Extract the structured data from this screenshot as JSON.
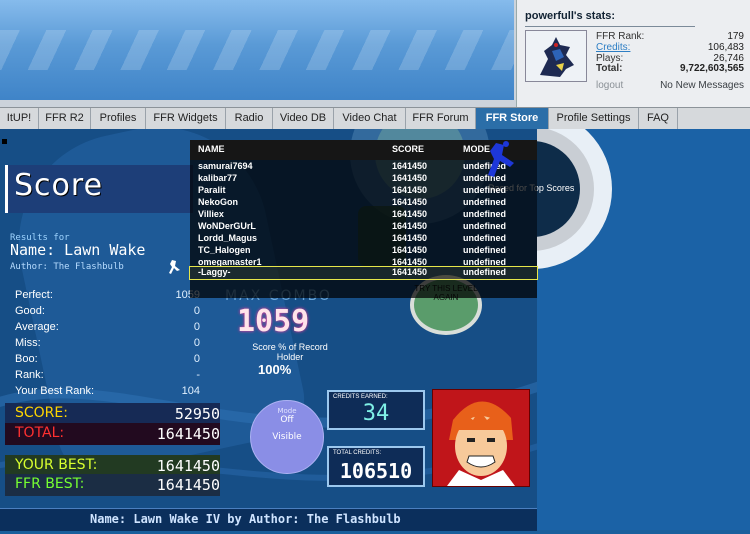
{
  "stats": {
    "title": "powerfull's stats:",
    "rows": [
      {
        "label": "FFR Rank:",
        "value": "179"
      },
      {
        "label": "Credits:",
        "value": "106,483"
      },
      {
        "label": "Plays:",
        "value": "26,746"
      },
      {
        "label": "Total:",
        "value": "9,722,603,565"
      }
    ],
    "logout": "logout",
    "messages": "No New Messages"
  },
  "nav": [
    {
      "label": "ItUP!"
    },
    {
      "label": "FFR R2"
    },
    {
      "label": "Profiles"
    },
    {
      "label": "FFR Widgets"
    },
    {
      "label": "Radio"
    },
    {
      "label": "Video DB"
    },
    {
      "label": "Video Chat"
    },
    {
      "label": "FFR Forum"
    },
    {
      "label": "FFR Store"
    },
    {
      "label": "Profile Settings"
    },
    {
      "label": "FAQ"
    }
  ],
  "results": {
    "title": "Score",
    "results_for": "Results for",
    "song_name": "Name: Lawn Wake",
    "author": "Author: The Flashbulb",
    "stats": [
      {
        "label": "Perfect:",
        "value": "1059"
      },
      {
        "label": "Good:",
        "value": "0"
      },
      {
        "label": "Average:",
        "value": "0"
      },
      {
        "label": "Miss:",
        "value": "0"
      },
      {
        "label": "Boo:",
        "value": "0"
      },
      {
        "label": "Rank:",
        "value": "-"
      },
      {
        "label": "Your Best Rank:",
        "value": "104"
      }
    ],
    "max_combo_label": "MAX COMBO",
    "max_combo": "1059",
    "pct_label": "Score % of Record Holder",
    "pct_value": "100%",
    "score_label": "SCORE:",
    "score_value": "52950",
    "total_label": "TOTAL:",
    "total_value": "1641450",
    "your_best_label": "YOUR BEST:",
    "your_best_value": "1641450",
    "ffr_best_label": "FFR BEST:",
    "ffr_best_value": "1641450",
    "circle_top": "Mode",
    "circle_mid": "Off",
    "circle_bottom": "Visible",
    "credits_earned_label": "CREDITS EARNED:",
    "credits_earned": "34",
    "total_credits_label": "TOTAL CREDITS:",
    "total_credits": "106510",
    "try_level": "TRY THIS LEVEL AGAIN",
    "raced_for": "Raced for Top Scores",
    "footer": "Name: Lawn Wake IV by Author: The Flashbulb"
  },
  "scoreboard": {
    "headers": {
      "name": "NAME",
      "score": "SCORE",
      "mode": "MODE"
    },
    "rows": [
      {
        "name": "samurai7694",
        "score": "1641450",
        "mode": "undefined"
      },
      {
        "name": "kalibar77",
        "score": "1641450",
        "mode": "undefined"
      },
      {
        "name": "Paralit",
        "score": "1641450",
        "mode": "undefined"
      },
      {
        "name": "NekoGon",
        "score": "1641450",
        "mode": "undefined"
      },
      {
        "name": "Villiex",
        "score": "1641450",
        "mode": "undefined"
      },
      {
        "name": "WoNDerGUrL",
        "score": "1641450",
        "mode": "undefined"
      },
      {
        "name": "Lordd_Magus",
        "score": "1641450",
        "mode": "undefined"
      },
      {
        "name": "TC_Halogen",
        "score": "1641450",
        "mode": "undefined"
      },
      {
        "name": "omegamaster1",
        "score": "1641450",
        "mode": "undefined"
      },
      {
        "name": "-Laggy-",
        "score": "1641450",
        "mode": "undefined"
      }
    ]
  }
}
